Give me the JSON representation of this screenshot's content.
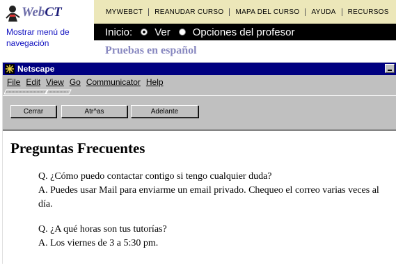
{
  "webct": {
    "logo_prefix": "Web",
    "logo_suffix": "CT",
    "nav_toggle": "Mostrar menú de navegación",
    "top_nav": [
      "MYWEBCT",
      "REANUDAR CURSO",
      "MAPA DEL CURSO",
      "AYUDA",
      "RECURSOS"
    ],
    "mode_label": "Inicio:",
    "mode_options": [
      "Ver",
      "Opciones del profesor"
    ],
    "mode_selected": "Ver",
    "course_title": "Pruebas en español"
  },
  "netscape": {
    "window_title": "Netscape",
    "menu": [
      "File",
      "Edit",
      "View",
      "Go",
      "Communicator",
      "Help"
    ],
    "buttons": {
      "close": "Cerrar",
      "back": "Atr^as",
      "forward": "Adelante"
    }
  },
  "page": {
    "heading": "Preguntas Frecuentes",
    "faqs": [
      {
        "q": "Q. ¿Cómo puedo contactar contigo si tengo cualquier duda?",
        "a": "A. Puedes usar Mail para enviarme un email privado. Chequeo el correo varias veces al día."
      },
      {
        "q": "Q. ¿A qué horas son tus tutorías?",
        "a": "A. Los viernes de 3 a 5:30 pm."
      }
    ]
  },
  "colors": {
    "topnav_bg": "#ece7b9",
    "modebar_bg": "#000000",
    "titlebar_bg": "#000080",
    "course_title": "#8888c0",
    "link": "#1010c0"
  }
}
